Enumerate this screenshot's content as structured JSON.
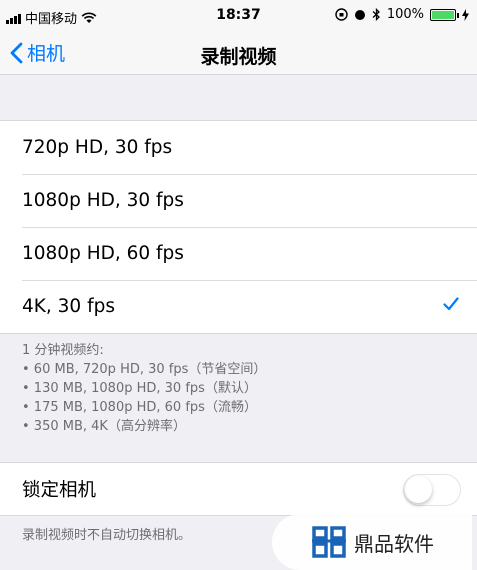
{
  "status_bar": {
    "carrier": "中国移动",
    "time": "18:37",
    "battery_percent": "100%",
    "battery_level": 1.0,
    "battery_color": "#4cd964"
  },
  "nav": {
    "back_label": "相机",
    "title": "录制视频",
    "accent_color": "#007aff"
  },
  "options": [
    {
      "label": "720p HD, 30 fps",
      "selected": false
    },
    {
      "label": "1080p HD, 30 fps",
      "selected": false
    },
    {
      "label": "1080p HD, 60 fps",
      "selected": false
    },
    {
      "label": "4K, 30 fps",
      "selected": true
    }
  ],
  "footnote": {
    "heading": "1 分钟视频约:",
    "lines": [
      "• 60 MB, 720p HD, 30 fps（节省空间）",
      "• 130 MB, 1080p HD, 30 fps（默认）",
      "• 175 MB, 1080p HD, 60 fps（流畅）",
      "• 350 MB, 4K（高分辨率）"
    ]
  },
  "lock_camera": {
    "label": "锁定相机",
    "enabled": false,
    "footnote": "录制视频时不自动切换相机。"
  },
  "watermark": {
    "text": "鼎品软件"
  }
}
